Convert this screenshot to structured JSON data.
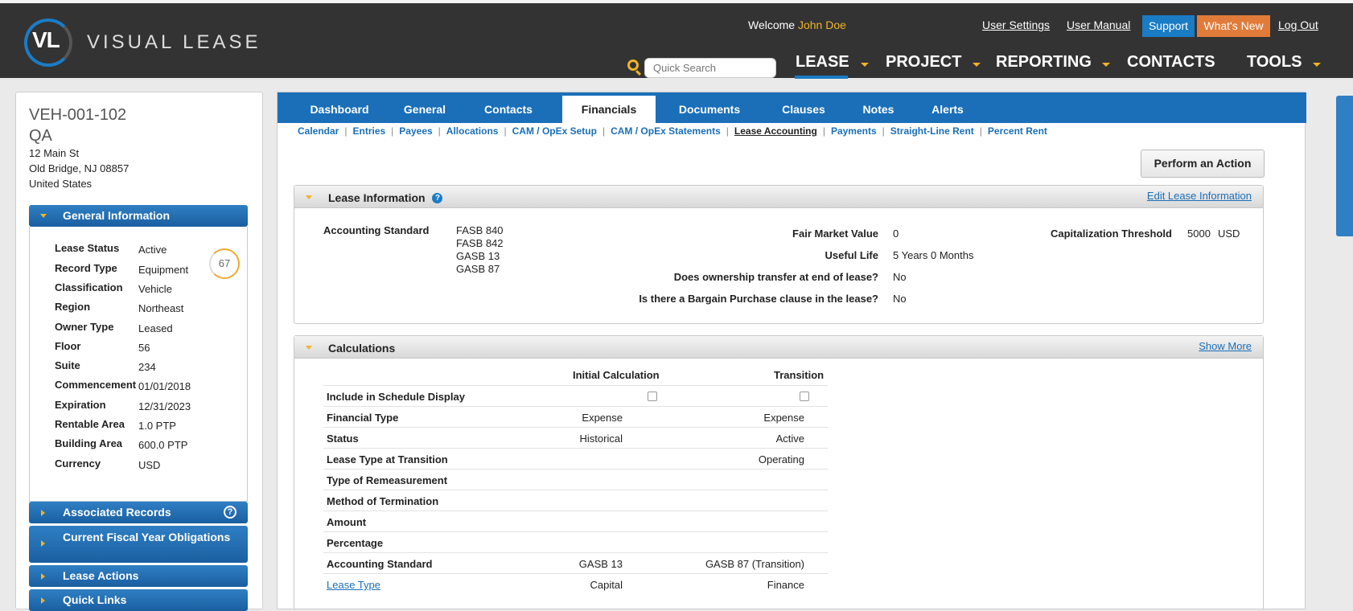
{
  "header": {
    "logo_mark": "VL",
    "logo_text": "VISUAL LEASE",
    "welcome_prefix": "Welcome",
    "user_name": "John Doe",
    "links": {
      "user_settings": "User Settings",
      "user_manual": "User Manual",
      "support": "Support",
      "whats_new": "What's New",
      "log_out": "Log Out"
    },
    "search_placeholder": "Quick Search",
    "nav": [
      "LEASE",
      "PROJECT",
      "REPORTING",
      "CONTACTS",
      "TOOLS"
    ],
    "active_nav": "LEASE"
  },
  "record": {
    "id": "VEH-001-102",
    "name": "QA",
    "address_line1": "12 Main St",
    "address_line2": "Old Bridge, NJ 08857",
    "country": "United States"
  },
  "general_info": {
    "title": "General Information",
    "score": "67",
    "fields": [
      {
        "label": "Lease Status",
        "value": "Active"
      },
      {
        "label": "Record Type",
        "value": "Equipment"
      },
      {
        "label": "Classification",
        "value": "Vehicle"
      },
      {
        "label": "Region",
        "value": "Northeast"
      },
      {
        "label": "Owner Type",
        "value": "Leased"
      },
      {
        "label": "Floor",
        "value": "56"
      },
      {
        "label": "Suite",
        "value": "234"
      },
      {
        "label": "Commencement",
        "value": "01/01/2018"
      },
      {
        "label": "Expiration",
        "value": "12/31/2023"
      },
      {
        "label": "Rentable Area",
        "value": "1.0 PTP"
      },
      {
        "label": "Building Area",
        "value": "600.0 PTP"
      },
      {
        "label": "Currency",
        "value": "USD"
      }
    ]
  },
  "side_panels": [
    {
      "label": "Associated Records"
    },
    {
      "label": "Current Fiscal Year Obligations"
    },
    {
      "label": "Lease Actions"
    },
    {
      "label": "Quick Links"
    }
  ],
  "tabs": [
    "Dashboard",
    "General",
    "Contacts",
    "Financials",
    "Documents",
    "Clauses",
    "Notes",
    "Alerts"
  ],
  "active_tab": "Financials",
  "subnav": [
    "Calendar",
    "Entries",
    "Payees",
    "Allocations",
    "CAM / OpEx Setup",
    "CAM / OpEx Statements",
    "Lease Accounting",
    "Payments",
    "Straight-Line Rent",
    "Percent Rent"
  ],
  "active_subnav": "Lease Accounting",
  "perform_action": "Perform an Action",
  "lease_info": {
    "title": "Lease Information",
    "edit_link": "Edit Lease Information",
    "accounting_standard_label": "Accounting Standard",
    "accounting_standards": [
      "FASB 840",
      "FASB 842",
      "GASB 13",
      "GASB 87"
    ],
    "fair_market_value_label": "Fair Market Value",
    "fair_market_value": "0",
    "useful_life_label": "Useful Life",
    "useful_life": "5 Years 0 Months",
    "ownership_transfer_label": "Does ownership transfer at end of lease?",
    "ownership_transfer": "No",
    "bargain_purchase_label": "Is there a Bargain Purchase clause in the lease?",
    "bargain_purchase": "No",
    "cap_threshold_label": "Capitalization Threshold",
    "cap_threshold": "5000",
    "cap_threshold_currency": "USD"
  },
  "calculations": {
    "title": "Calculations",
    "show_more": "Show More",
    "col_initial": "Initial Calculation",
    "col_transition": "Transition",
    "rows": [
      {
        "label": "Include in Schedule Display",
        "initial": "",
        "transition": ""
      },
      {
        "label": "Financial Type",
        "initial": "Expense",
        "transition": "Expense"
      },
      {
        "label": "Status",
        "initial": "Historical",
        "transition": "Active"
      },
      {
        "label": "Lease Type at Transition",
        "initial": "",
        "transition": "Operating"
      },
      {
        "label": "Type of Remeasurement",
        "initial": "",
        "transition": ""
      },
      {
        "label": "Method of Termination",
        "initial": "",
        "transition": ""
      },
      {
        "label": "Amount",
        "initial": "",
        "transition": ""
      },
      {
        "label": "Percentage",
        "initial": "",
        "transition": ""
      },
      {
        "label": "Accounting Standard",
        "initial": "GASB 13",
        "transition": "GASB 87 (Transition)"
      },
      {
        "label": "Lease Type",
        "initial": "Capital",
        "transition": "Finance"
      }
    ]
  }
}
